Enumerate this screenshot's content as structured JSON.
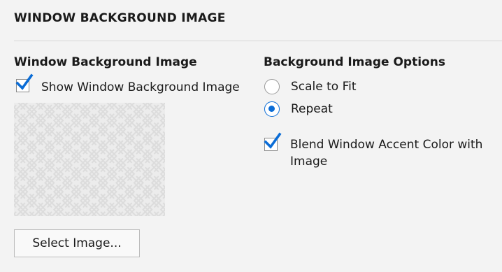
{
  "section": {
    "title": "WINDOW BACKGROUND IMAGE"
  },
  "left": {
    "group_title": "Window Background Image",
    "show_checkbox": {
      "label": "Show Window Background Image",
      "checked": true
    },
    "preview": {
      "pattern": "light-gray-sayagata-pattern"
    },
    "select_button": "Select Image..."
  },
  "right": {
    "group_title": "Background Image Options",
    "radios": [
      {
        "label": "Scale to Fit",
        "checked": false
      },
      {
        "label": "Repeat",
        "checked": true
      }
    ],
    "blend_checkbox": {
      "label": "Blend Window Accent Color with Image",
      "checked": true
    }
  },
  "colors": {
    "accent": "#0a6cd6",
    "background": "#f3f3f3"
  }
}
